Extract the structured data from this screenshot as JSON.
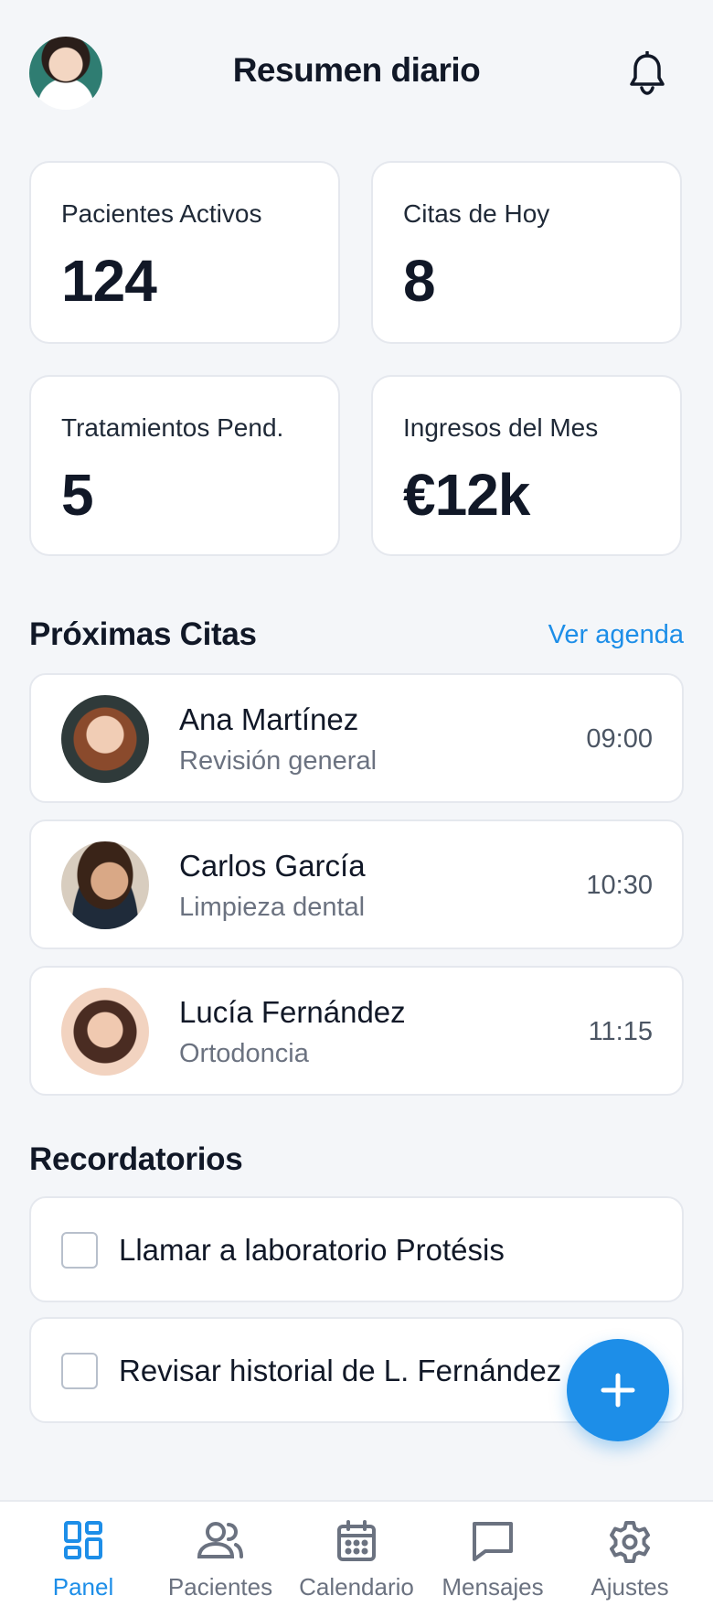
{
  "header": {
    "title": "Resumen diario"
  },
  "stats": [
    {
      "label": "Pacientes Activos",
      "value": "124"
    },
    {
      "label": "Citas de Hoy",
      "value": "8"
    },
    {
      "label": "Tratamientos Pend.",
      "value": "5"
    },
    {
      "label": "Ingresos del Mes",
      "value": "€12k"
    }
  ],
  "appointments": {
    "title": "Próximas Citas",
    "link": "Ver agenda",
    "items": [
      {
        "name": "Ana Martínez",
        "treatment": "Revisión general",
        "time": "09:00"
      },
      {
        "name": "Carlos García",
        "treatment": "Limpieza dental",
        "time": "10:30"
      },
      {
        "name": "Lucía Fernández",
        "treatment": "Ortodoncia",
        "time": "11:15"
      }
    ]
  },
  "reminders": {
    "title": "Recordatorios",
    "items": [
      {
        "text": "Llamar a laboratorio Protésis"
      },
      {
        "text": "Revisar historial de L. Fernández"
      }
    ]
  },
  "nav": {
    "items": [
      {
        "label": "Panel",
        "icon": "dashboard-icon",
        "active": true
      },
      {
        "label": "Pacientes",
        "icon": "users-icon"
      },
      {
        "label": "Calendario",
        "icon": "calendar-icon"
      },
      {
        "label": "Mensajes",
        "icon": "message-icon"
      },
      {
        "label": "Ajustes",
        "icon": "gear-icon"
      }
    ]
  },
  "colors": {
    "accent": "#1d8ee8",
    "background": "#f4f6f9",
    "text": "#111827",
    "muted": "#6b7280"
  }
}
